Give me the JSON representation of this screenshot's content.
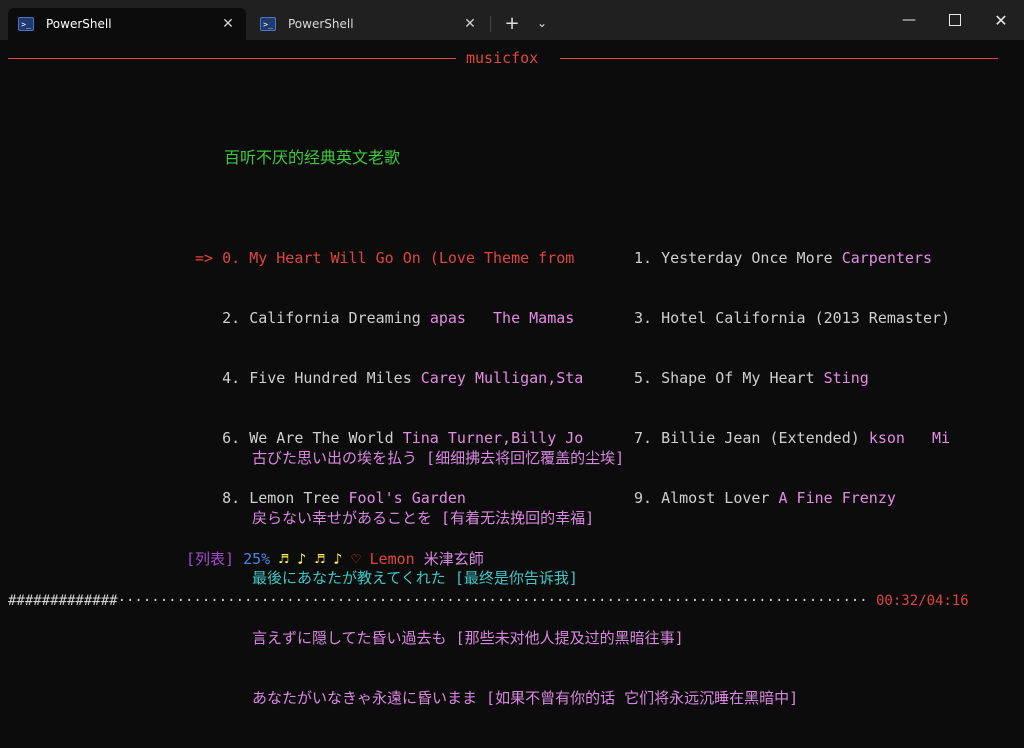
{
  "window": {
    "tabs": [
      {
        "label": "PowerShell",
        "active": true
      },
      {
        "label": "PowerShell",
        "active": false
      }
    ],
    "icons": {
      "tab_icon": "powershell-icon",
      "close": "close-icon",
      "new_tab": "plus-icon",
      "dropdown": "chevron-down-icon",
      "minimize": "minimize-icon",
      "maximize": "maximize-icon",
      "window_close": "close-icon"
    },
    "glyphs": {
      "close": "✕",
      "plus": "+",
      "down": "⌄",
      "min": "—"
    }
  },
  "app": {
    "title": "musicfox"
  },
  "playlist": {
    "title": "百听不厌的经典英文老歌",
    "cursor": "=>",
    "left": [
      {
        "num": "0.",
        "name": "My Heart Will Go On (Love Theme from",
        "artist": "",
        "current": true
      },
      {
        "num": "2.",
        "name": "California Dreaming",
        "artist": "apas   The Mamas",
        "current": false
      },
      {
        "num": "4.",
        "name": "Five Hundred Miles",
        "artist": "Carey Mulligan,Sta",
        "current": false
      },
      {
        "num": "6.",
        "name": "We Are The World",
        "artist": "Tina Turner,Billy Jo",
        "current": false
      },
      {
        "num": "8.",
        "name": "Lemon Tree",
        "artist": "Fool's Garden",
        "current": false
      }
    ],
    "right": [
      {
        "num": "1.",
        "name": "Yesterday Once More",
        "artist": "Carpenters",
        "current": false
      },
      {
        "num": "3.",
        "name": "Hotel California (2013 Remaster)",
        "artist": "",
        "current": false
      },
      {
        "num": "5.",
        "name": "Shape Of My Heart",
        "artist": "Sting",
        "current": false
      },
      {
        "num": "7.",
        "name": "Billie Jean (Extended)",
        "artist": "kson   Mi",
        "current": false
      },
      {
        "num": "9.",
        "name": "Almost Lover",
        "artist": "A Fine Frenzy",
        "current": false
      }
    ]
  },
  "lyrics": [
    {
      "text": "古びた思い出の埃を払う [细细拂去将回忆覆盖的尘埃]",
      "highlight": false
    },
    {
      "text": "戻らない幸せがあることを [有着无法挽回的幸福]",
      "highlight": false
    },
    {
      "text": "最後にあなたが教えてくれた [最终是你告诉我]",
      "highlight": true
    },
    {
      "text": "言えずに隠してた昏い過去も [那些未对他人提及过的黑暗往事]",
      "highlight": false
    },
    {
      "text": "あなたがいなきゃ永遠に昏いまま [如果不曾有你的话 它们将永远沉睡在黑暗中]",
      "highlight": false
    }
  ],
  "status": {
    "tag": "[列表]",
    "percent": "25%",
    "notes": "♬ ♪ ♬ ♪",
    "heart": "♡",
    "song": "Lemon",
    "artist": "米津玄師"
  },
  "progress": {
    "fraction": 0.125,
    "filled_char": "#",
    "empty_char": "·",
    "time": "00:32/04:16"
  },
  "colors": {
    "accent_red": "#e0453f",
    "green": "#3ec93e",
    "artist_pink": "#e48ce4",
    "highlight_cyan": "#3fc7c7",
    "purple": "#a64ad0",
    "blue": "#4a86e8",
    "yellow": "#ffff55"
  }
}
